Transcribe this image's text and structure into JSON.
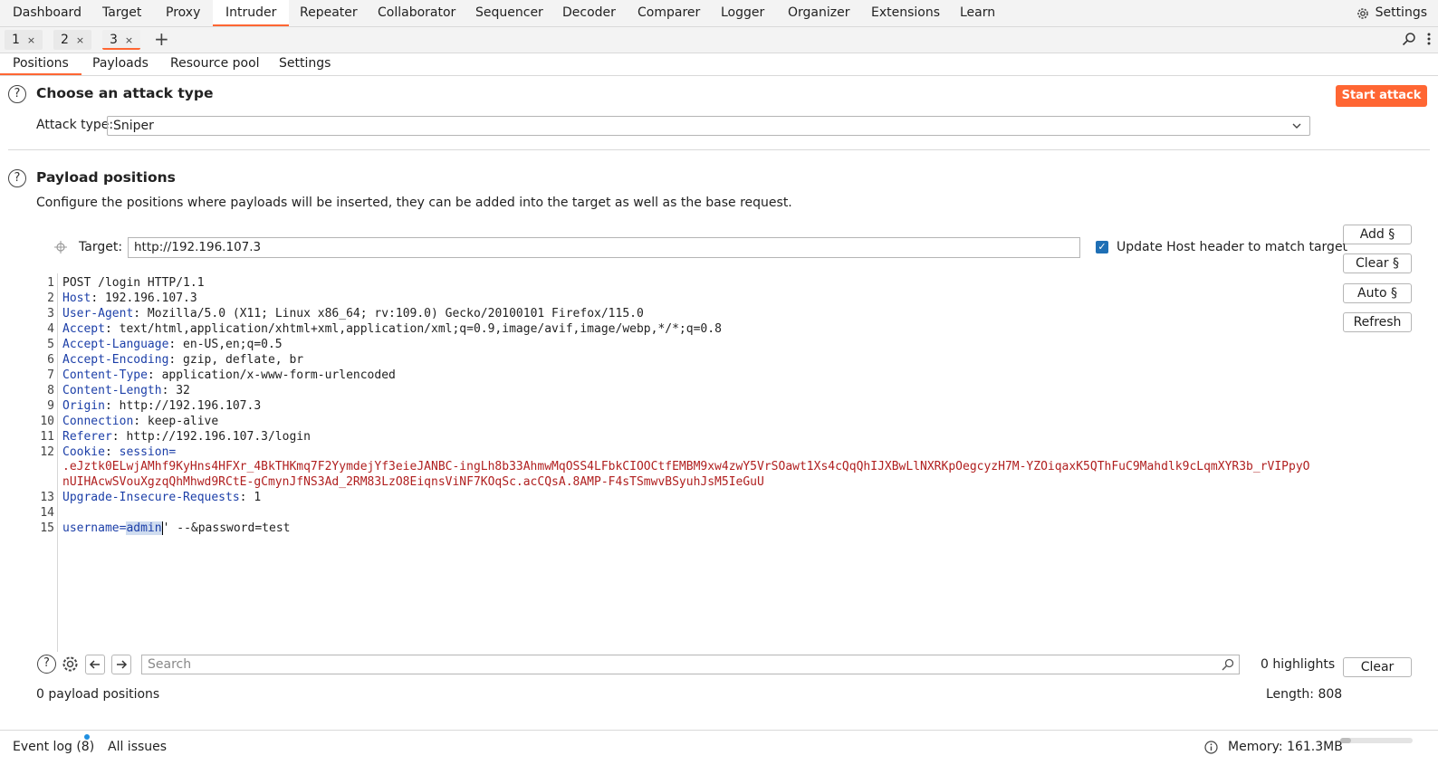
{
  "topnav": {
    "items": [
      "Dashboard",
      "Target",
      "Proxy",
      "Intruder",
      "Repeater",
      "Collaborator",
      "Sequencer",
      "Decoder",
      "Comparer",
      "Logger",
      "Organizer",
      "Extensions",
      "Learn"
    ],
    "active": "Intruder",
    "settings_label": "Settings"
  },
  "tabs": [
    {
      "label": "1",
      "close": "×"
    },
    {
      "label": "2",
      "close": "×"
    },
    {
      "label": "3",
      "close": "×"
    }
  ],
  "add_tab": "+",
  "subtabs": [
    "Positions",
    "Payloads",
    "Resource pool",
    "Settings"
  ],
  "attack_section": {
    "help": "?",
    "title": "Choose an attack type",
    "start_button": "Start attack",
    "attack_type_label": "Attack type:",
    "attack_type_value": "Sniper"
  },
  "positions_section": {
    "help": "?",
    "title": "Payload positions",
    "description": "Configure the positions where payloads will be inserted, they can be added into the target as well as the base request.",
    "target_label": "Target:",
    "target_value": "http://192.196.107.3",
    "update_host_label": "Update Host header to match target",
    "update_host_checked": true,
    "buttons": [
      "Add §",
      "Clear §",
      "Auto §",
      "Refresh"
    ]
  },
  "request": {
    "line1": "POST /login HTTP/1.1",
    "headers": [
      {
        "n": "2",
        "name": "Host",
        "value": " 192.196.107.3"
      },
      {
        "n": "3",
        "name": "User-Agent",
        "value": " Mozilla/5.0 (X11; Linux x86_64; rv:109.0) Gecko/20100101 Firefox/115.0"
      },
      {
        "n": "4",
        "name": "Accept",
        "value": " text/html,application/xhtml+xml,application/xml;q=0.9,image/avif,image/webp,*/*;q=0.8"
      },
      {
        "n": "5",
        "name": "Accept-Language",
        "value": " en-US,en;q=0.5"
      },
      {
        "n": "6",
        "name": "Accept-Encoding",
        "value": " gzip, deflate, br"
      },
      {
        "n": "7",
        "name": "Content-Type",
        "value": " application/x-www-form-urlencoded"
      },
      {
        "n": "8",
        "name": "Content-Length",
        "value": " 32"
      },
      {
        "n": "9",
        "name": "Origin",
        "value": " http://192.196.107.3"
      },
      {
        "n": "10",
        "name": "Connection",
        "value": " keep-alive"
      },
      {
        "n": "11",
        "name": "Referer",
        "value": " http://192.196.107.3/login"
      }
    ],
    "cookie_name": "Cookie",
    "cookie_key": " session=",
    "cookie_value_line1": ".eJztk0ELwjAMhf9KyHns4HFXr_4BkTHKmq7F2YymdejYf3eieJANBC-ingLh8b33AhmwMqOSS4LFbkCIOOCtfEMBM9xw4zwY5VrSOawt1Xs4cQqQhIJXBwLlNXRKpOegcyzH7M-YZOiqaxK5QThFuC9Mahdlk9cLqmXYR3b_rVIPpyO",
    "cookie_value_line2": "nUIHAcwSVouXgzqQhMhwd9RCtE-gCmynJfNS3Ad_2RM83LzO8EiqnsViNF7KOqSc.acCQsA.8AMP-F4sTSmwvBSyuhJsM5IeGuU",
    "upgrade_name": "Upgrade-Insecure-Requests",
    "upgrade_value": " 1",
    "body_key": "username",
    "body_eq": "=",
    "body_selected": "admin",
    "body_rest": "' --&password=test"
  },
  "line_numbers": [
    "1",
    "2",
    "3",
    "4",
    "5",
    "6",
    "7",
    "8",
    "9",
    "10",
    "11",
    "12",
    "13",
    "14",
    "15"
  ],
  "search": {
    "placeholder": "Search",
    "highlights": "0 highlights",
    "clear_label": "Clear"
  },
  "footer": {
    "payload_positions": "0 payload positions",
    "length": "Length: 808"
  },
  "statusbar": {
    "event_log": "Event log (8)",
    "all_issues": "All issues",
    "memory": "Memory: 161.3MB"
  },
  "colors": {
    "accent": "#ff6633",
    "header_name": "#1c3fa8",
    "cookie_value": "#b01f1f"
  }
}
